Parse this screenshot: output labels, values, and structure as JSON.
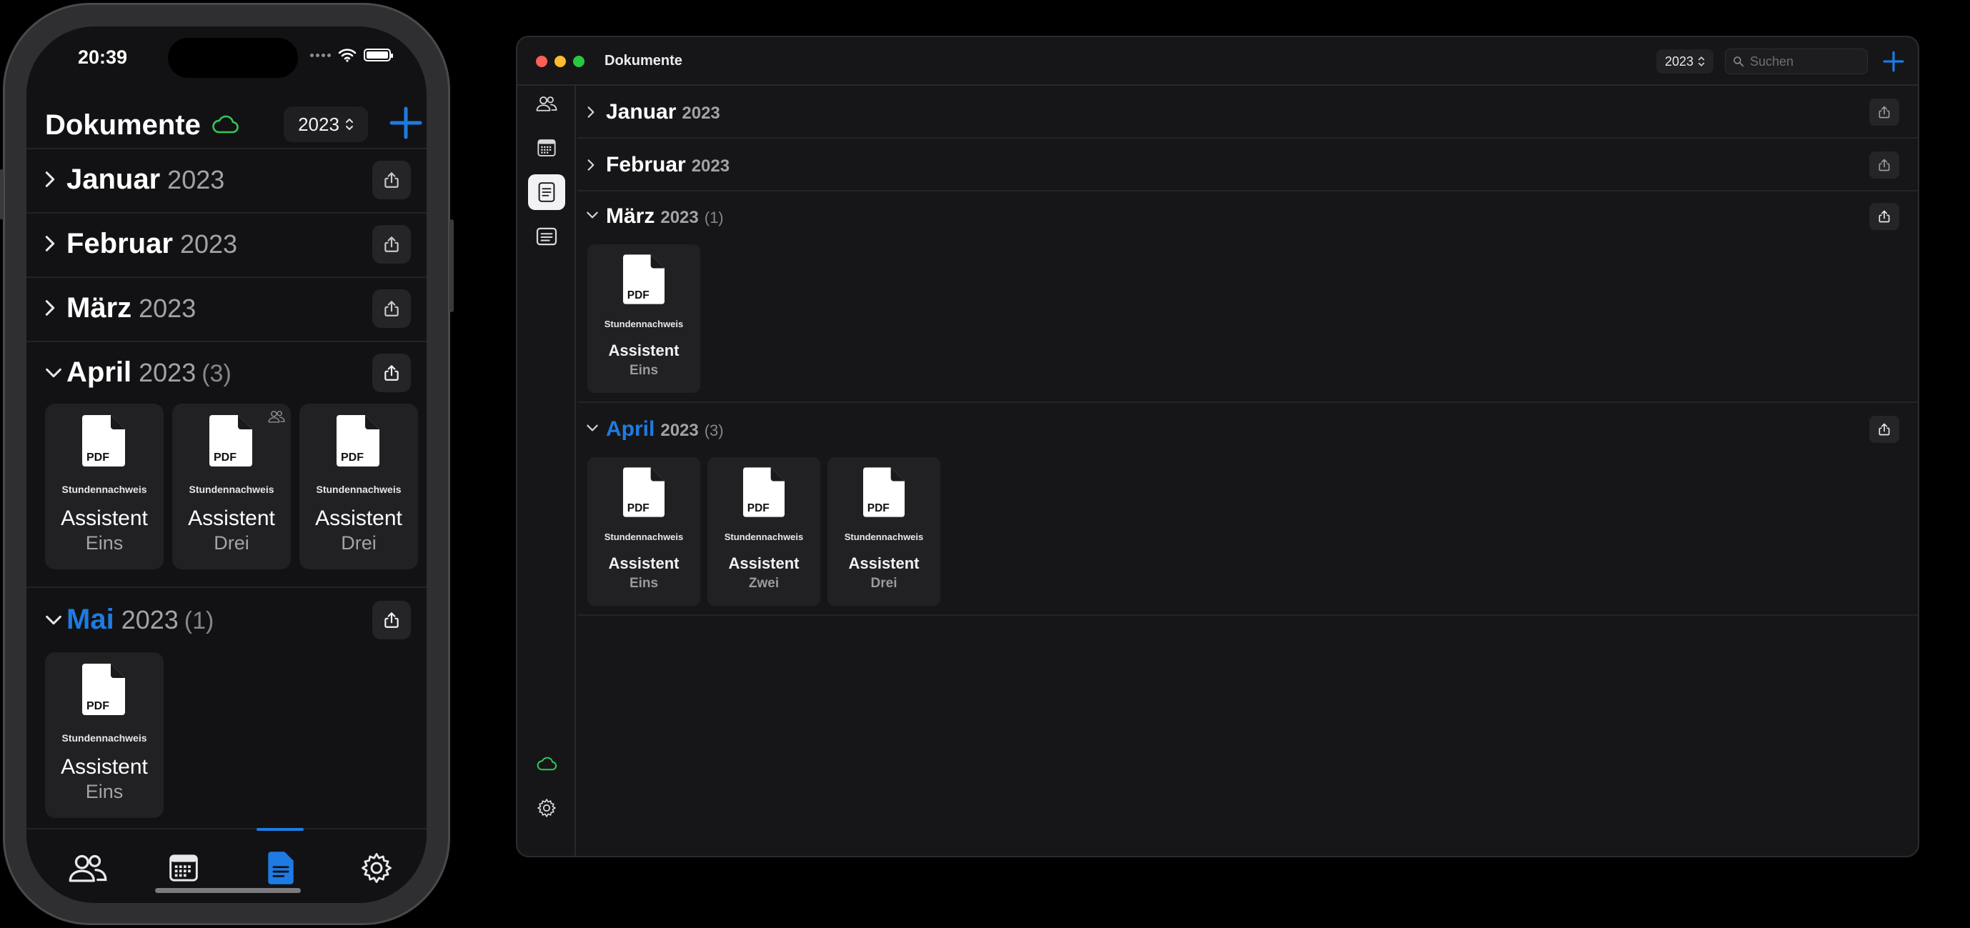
{
  "colors": {
    "accent": "#1e7be3",
    "cloud": "#34c759",
    "close": "#ff5f57",
    "minimize": "#febc2e",
    "zoom": "#28c840"
  },
  "phone": {
    "time": "20:39",
    "title": "Dokumente",
    "year": "2023",
    "months": [
      {
        "name": "Januar",
        "year": "2023",
        "count": ""
      },
      {
        "name": "Februar",
        "year": "2023",
        "count": ""
      },
      {
        "name": "März",
        "year": "2023",
        "count": ""
      },
      {
        "name": "April",
        "year": "2023",
        "count": "(3)"
      },
      {
        "name": "Mai",
        "year": "2023",
        "count": "(1)"
      }
    ],
    "april_docs": [
      {
        "label": "Stundennachweis",
        "line1": "Assistent",
        "line2": "Eins"
      },
      {
        "label": "Stundennachweis",
        "line1": "Assistent",
        "line2": "Drei"
      },
      {
        "label": "Stundennachweis",
        "line1": "Assistent",
        "line2": "Drei"
      }
    ],
    "mai_docs": [
      {
        "label": "Stundennachweis",
        "line1": "Assistent",
        "line2": "Eins"
      }
    ],
    "pdf": "PDF",
    "tabs": [
      "people-icon",
      "calendar-icon",
      "document-icon",
      "gear-icon"
    ]
  },
  "mac": {
    "title": "Dokumente",
    "year": "2023",
    "search_placeholder": "Suchen",
    "months": [
      {
        "name": "Januar",
        "year": "2023",
        "count": ""
      },
      {
        "name": "Februar",
        "year": "2023",
        "count": ""
      },
      {
        "name": "März",
        "year": "2023",
        "count": "(1)"
      },
      {
        "name": "April",
        "year": "2023",
        "count": "(3)"
      }
    ],
    "maerz_docs": [
      {
        "label": "Stundennachweis",
        "line1": "Assistent",
        "line2": "Eins"
      }
    ],
    "april_docs": [
      {
        "label": "Stundennachweis",
        "line1": "Assistent",
        "line2": "Eins"
      },
      {
        "label": "Stundennachweis",
        "line1": "Assistent",
        "line2": "Zwei"
      },
      {
        "label": "Stundennachweis",
        "line1": "Assistent",
        "line2": "Drei"
      }
    ],
    "pdf": "PDF"
  }
}
